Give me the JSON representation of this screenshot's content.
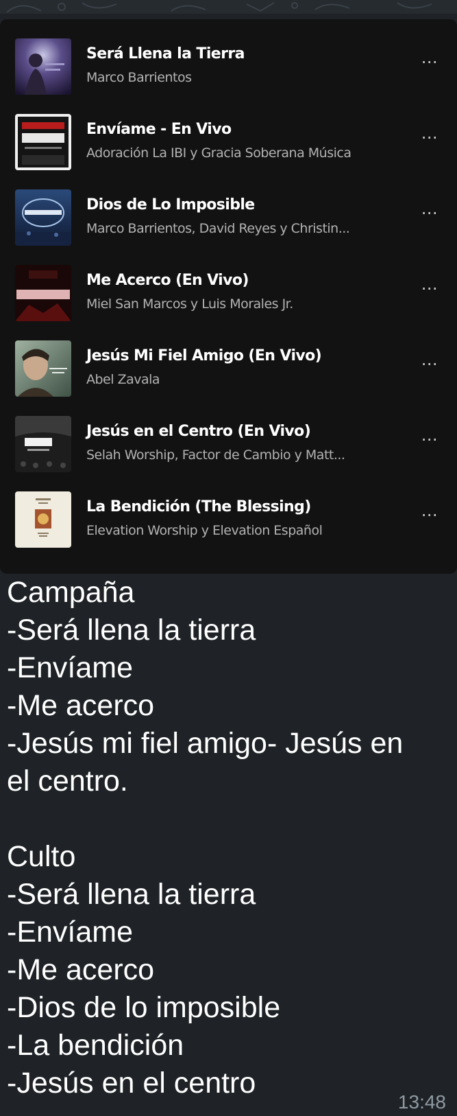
{
  "playlist": {
    "tracks": [
      {
        "title": "Será Llena la Tierra",
        "artist": "Marco Barrientos",
        "cover_icon": "album-cover-man-singing",
        "more_icon": "more-options-icon"
      },
      {
        "title": "Envíame - En Vivo",
        "artist": "Adoración La IBI y Gracia Soberana Música",
        "cover_icon": "album-cover-la-salvacion",
        "cover_text": "LA SALVACIÓN ES DEL SEÑOR",
        "more_icon": "more-options-icon"
      },
      {
        "title": "Dios de Lo Imposible",
        "artist": "Marco Barrientos, David Reyes y Christin...",
        "cover_icon": "album-cover-el-encuentro",
        "more_icon": "more-options-icon"
      },
      {
        "title": "Me Acerco (En Vivo)",
        "artist": "Miel San Marcos y Luis Morales Jr.",
        "cover_icon": "album-cover-pentecostes",
        "cover_text": "PENTECOSTÉS",
        "more_icon": "more-options-icon"
      },
      {
        "title": "Jesús Mi Fiel Amigo (En Vivo)",
        "artist": "Abel Zavala",
        "cover_icon": "album-cover-portrait",
        "more_icon": "more-options-icon"
      },
      {
        "title": "Jesús en el Centro (En Vivo)",
        "artist": "Selah Worship, Factor de Cambio y Matt...",
        "cover_icon": "album-cover-jesus",
        "cover_text": "Jesús",
        "more_icon": "more-options-icon"
      },
      {
        "title": "La Bendición (The Blessing)",
        "artist": "Elevation Worship y Elevation Español",
        "cover_icon": "album-cover-la-bendicion",
        "more_icon": "more-options-icon"
      }
    ]
  },
  "message": {
    "lines": [
      "Campaña",
      "-Será llena la tierra",
      "-Envíame",
      "-Me acerco",
      "-Jesús mi fiel amigo- Jesús en",
      "el centro.",
      "",
      "Culto",
      "-Será llena la tierra",
      "-Envíame",
      "-Me acerco",
      "-Dios de lo imposible",
      "-La bendición",
      "-Jesús en el centro"
    ],
    "timestamp": "13:48"
  },
  "colors": {
    "chat_background": "#1f2327",
    "card_background": "#121212",
    "title": "#ffffff",
    "subtitle": "#b3b3b3",
    "timestamp": "#8f9aa3"
  }
}
